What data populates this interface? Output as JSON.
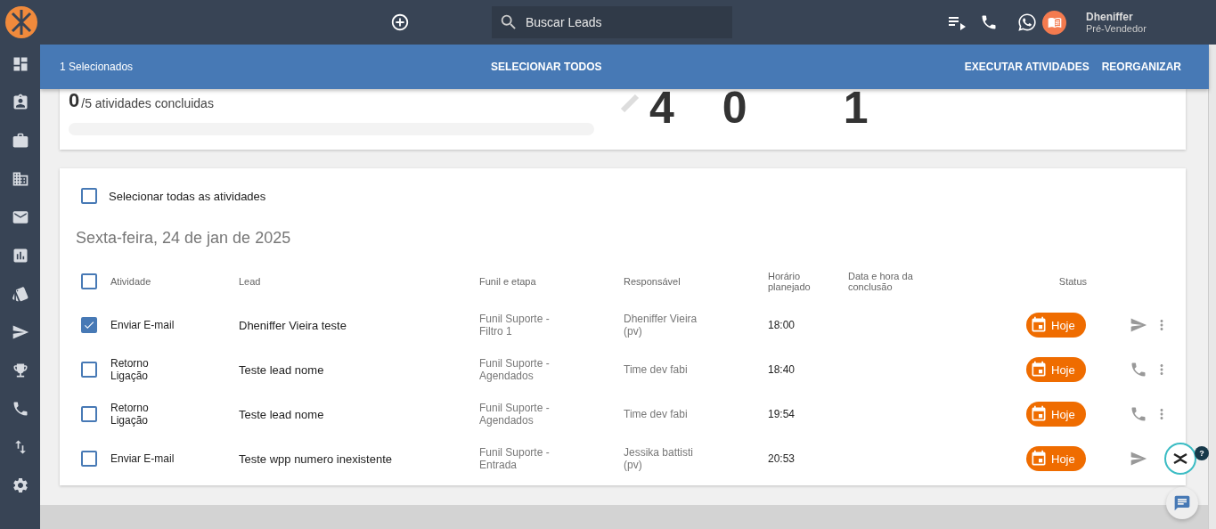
{
  "topbar": {
    "search": {
      "placeholder": "Buscar Leads"
    },
    "user": {
      "name": "Dheniffer",
      "role": "Pré-Vendedor"
    }
  },
  "selection_bar": {
    "count": "1 Selecionados",
    "select_all": "SELECIONAR TODOS",
    "actions": [
      "EXECUTAR ATIVIDADES",
      "REORGANIZAR"
    ]
  },
  "summary": {
    "done": "0",
    "label": "/5 atividades concluidas",
    "progress": {
      "level": 0
    },
    "counts": [
      "4",
      "0",
      "1"
    ]
  },
  "activities": {
    "select_all": {
      "label": "Selecionar todas as atividades",
      "checked": false
    },
    "date": "Sexta-feira, 24 de jan de 2025",
    "header_checked": false,
    "columns": [
      "Atividade",
      "Lead",
      "Funil e etapa",
      "Responsável",
      "Horário planejado",
      "Data e hora da conclusão",
      "Status"
    ],
    "rows": [
      {
        "checked": true,
        "activity": "Enviar E-mail",
        "lead": "Dheniffer Vieira teste",
        "funnel": "Funil Suporte - Filtro 1",
        "owner": "Dheniffer Vieira (pv)",
        "time": "18:00",
        "status": "Hoje",
        "kind": "email",
        "menu": true
      },
      {
        "checked": false,
        "activity": "Retorno Ligação",
        "lead": "Teste lead nome",
        "funnel": "Funil Suporte - Agendados",
        "owner": "Time dev fabi",
        "time": "18:40",
        "status": "Hoje",
        "kind": "call",
        "menu": true
      },
      {
        "checked": false,
        "activity": "Retorno Ligação",
        "lead": "Teste lead nome",
        "funnel": "Funil Suporte - Agendados",
        "owner": "Time dev fabi",
        "time": "19:54",
        "status": "Hoje",
        "kind": "call",
        "menu": true
      },
      {
        "checked": false,
        "activity": "Enviar E-mail",
        "lead": "Teste wpp numero inexistente",
        "funnel": "Funil Suporte - Entrada",
        "owner": "Jessika battisti (pv)",
        "time": "20:53",
        "status": "Hoje",
        "kind": "email",
        "menu": false
      }
    ]
  },
  "help_badge": "?"
}
